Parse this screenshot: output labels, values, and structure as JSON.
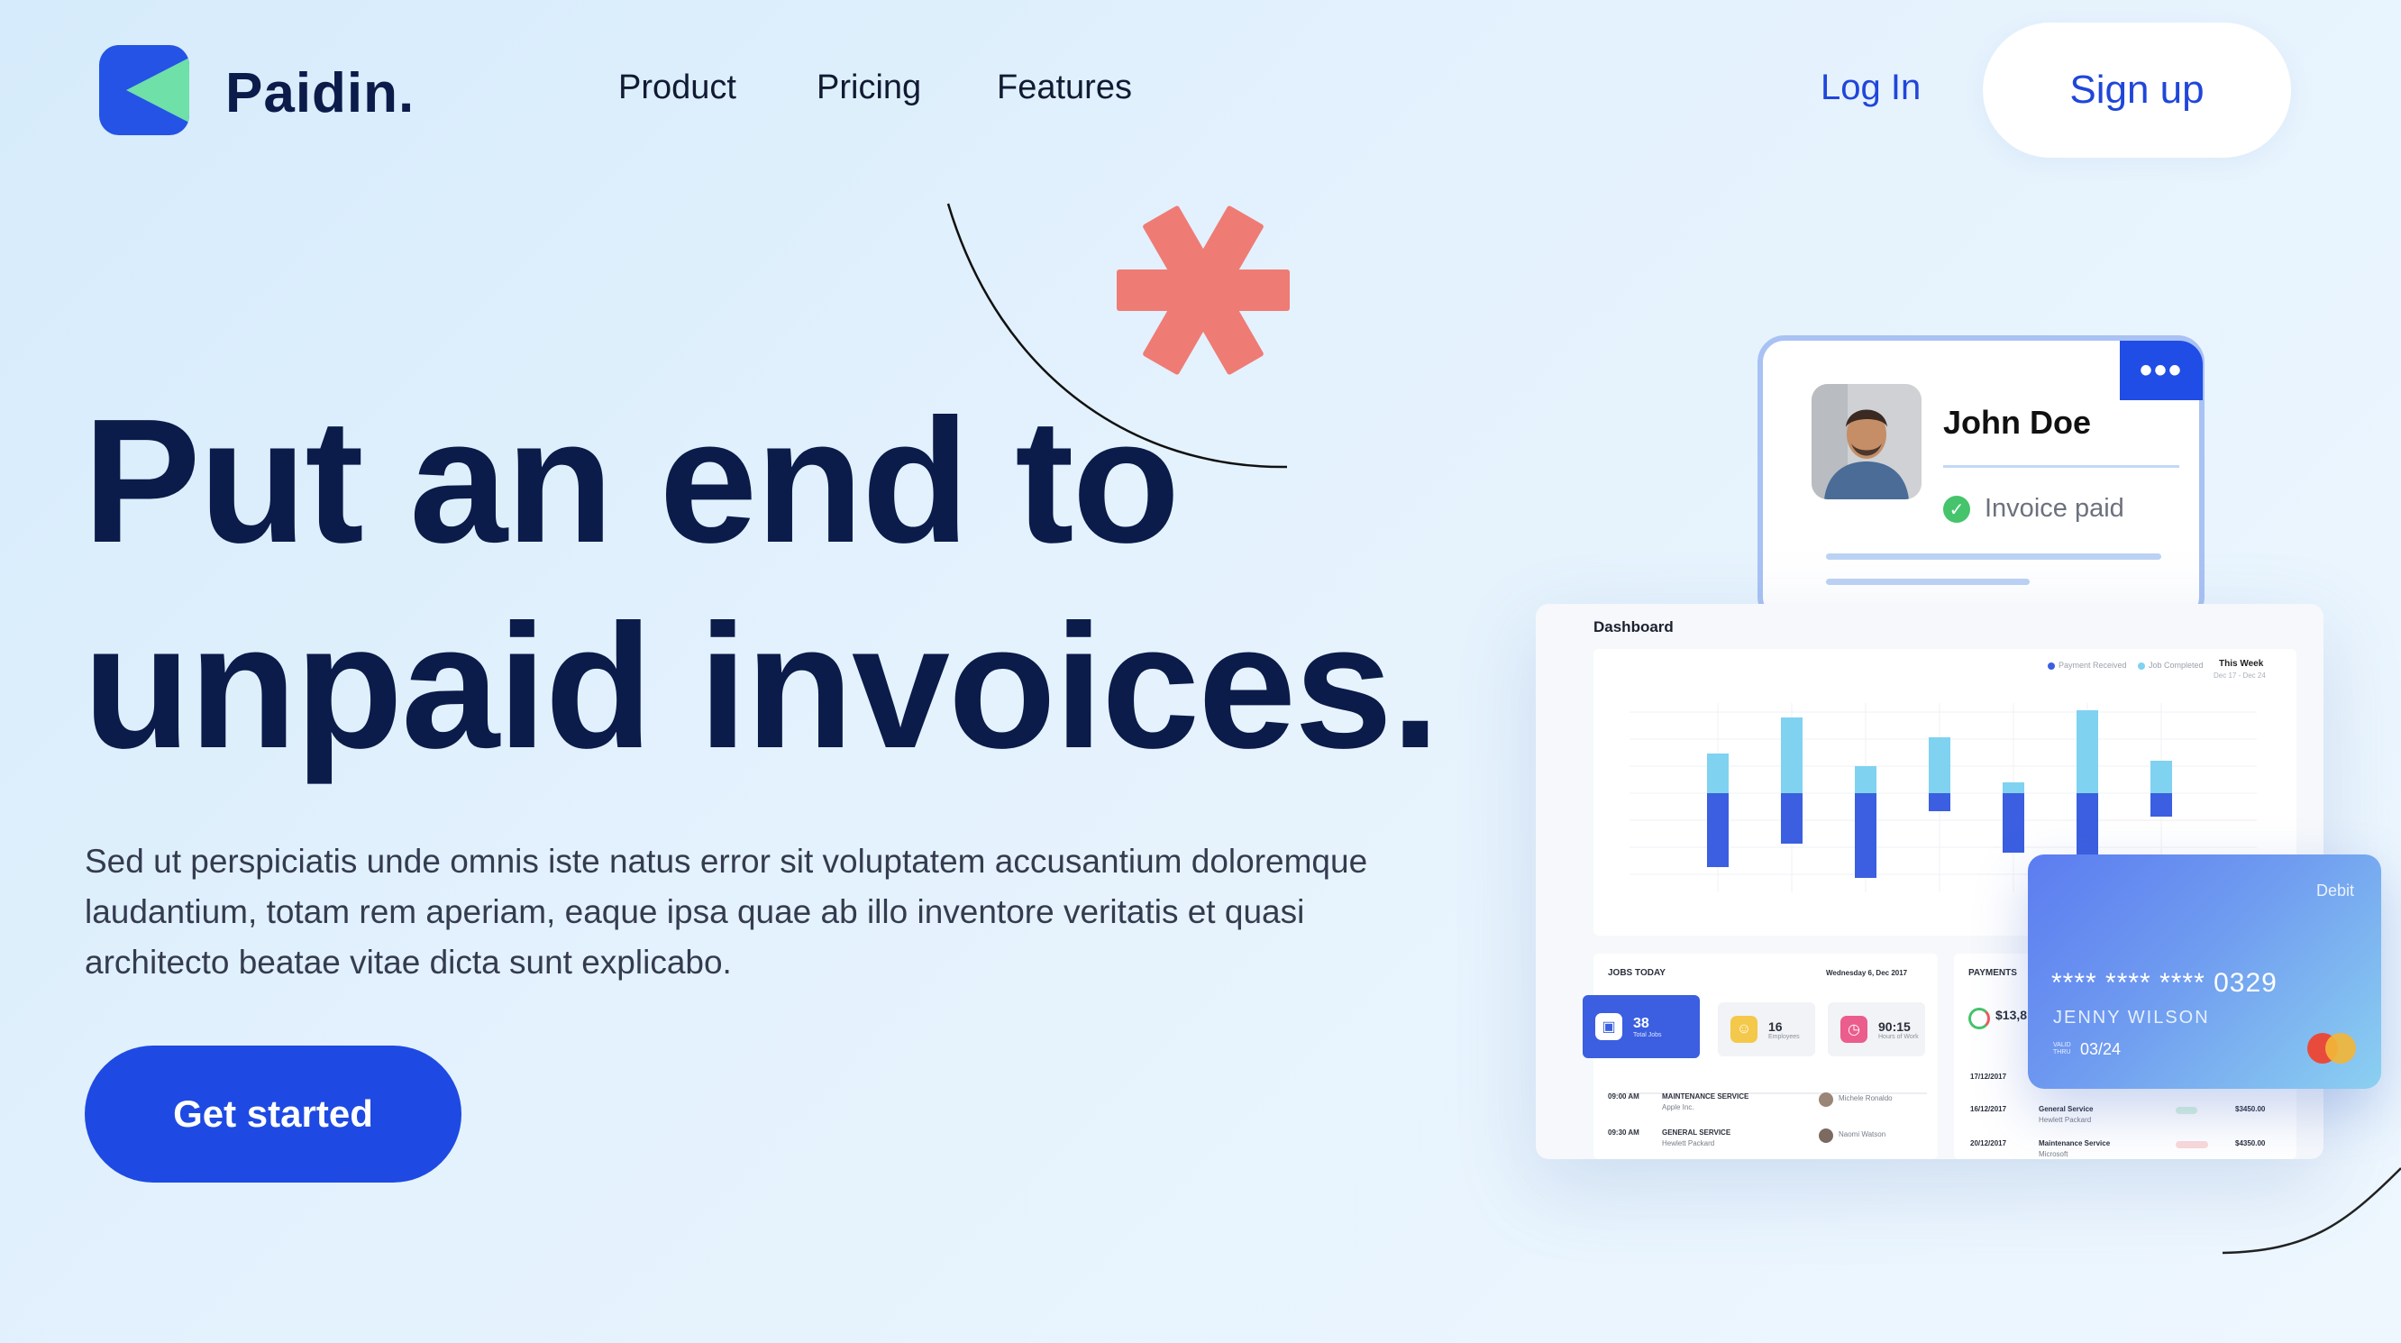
{
  "brand": {
    "name": "Paidin."
  },
  "nav": {
    "links": [
      "Product",
      "Pricing",
      "Features"
    ],
    "login": "Log In",
    "signup": "Sign up"
  },
  "hero": {
    "title_line1": "Put an end to",
    "title_line2": "unpaid invoices.",
    "description": "Sed ut perspiciatis unde omnis iste natus error sit voluptatem accusantium doloremque laudantium, totam rem aperiam, eaque ipsa quae ab illo inventore veritatis et quasi architecto beatae vitae dicta sunt explicabo.",
    "cta": "Get started"
  },
  "invoice_card": {
    "menu": "•••",
    "name": "John Doe",
    "status": "Invoice paid"
  },
  "dashboard": {
    "title": "Dashboard",
    "legend": [
      "Payment Received",
      "Job Completed"
    ],
    "week_label": "This Week",
    "week_range": "Dec 17 - Dec 24",
    "jobs": {
      "title": "JOBS TODAY",
      "date": "Wednesday 6, Dec 2017",
      "stats": [
        {
          "value": "38",
          "label": "Total Jobs"
        },
        {
          "value": "16",
          "label": "Employees"
        },
        {
          "value": "90:15",
          "label": "Hours of Work"
        }
      ],
      "rows": [
        {
          "time": "09:00 AM",
          "service": "MAINTENANCE SERVICE",
          "client": "Apple Inc.",
          "employee": "Michele Ronaldo"
        },
        {
          "time": "09:30 AM",
          "service": "GENERAL SERVICE",
          "client": "Hewlett Packard",
          "employee": "Naomi Watson"
        }
      ]
    },
    "payments": {
      "title": "PAYMENTS",
      "amount": "$13,8",
      "rows": [
        {
          "date": "17/12/2017",
          "service": "",
          "amount": ""
        },
        {
          "date": "16/12/2017",
          "service": "General Service",
          "client": "Hewlett Packard",
          "amount": "$3450.00"
        },
        {
          "date": "20/12/2017",
          "service": "Maintenance Service",
          "client": "Microsoft",
          "amount": "$4350.00"
        }
      ]
    }
  },
  "credit_card": {
    "type": "Debit",
    "number": "**** **** **** 0329",
    "holder": "JENNY WILSON",
    "valid_label": "VALID THRU",
    "expiry": "03/24"
  },
  "colors": {
    "primary": "#1e4ae3",
    "navy": "#0b1b4a",
    "accent_coral": "#ef7b75",
    "logo_green": "#6ee0a8"
  }
}
